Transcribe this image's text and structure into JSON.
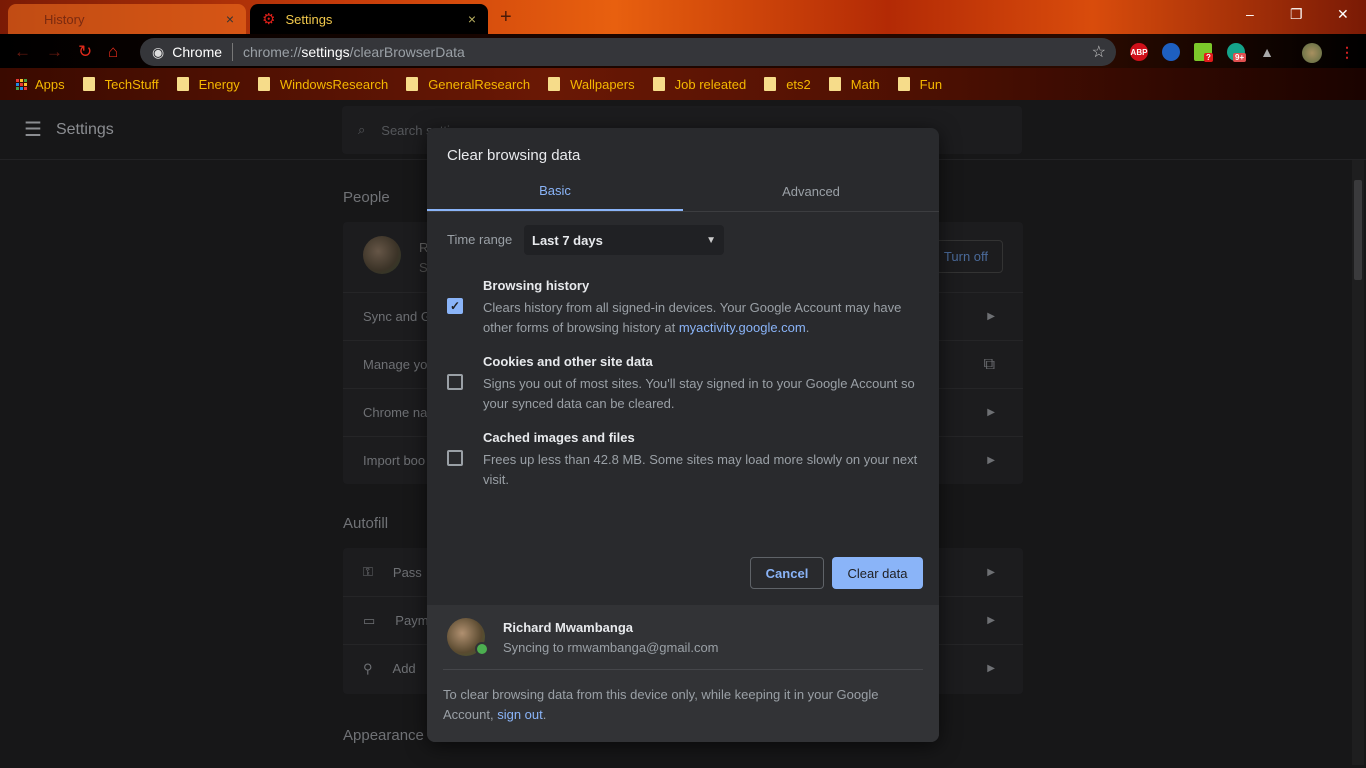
{
  "browser": {
    "tabs": [
      {
        "label": "History",
        "close": "×"
      },
      {
        "label": "Settings",
        "close": "×"
      }
    ],
    "new_tab": "+",
    "window_controls": {
      "minimize": "–",
      "restore": "❐",
      "close": "✕"
    },
    "omnibox": {
      "site": "Chrome",
      "url_prefix": "chrome://",
      "url_bold": "settings",
      "url_suffix": "/clearBrowserData"
    },
    "extensions": [
      {
        "name": "ABP",
        "color": "#d0101a"
      },
      {
        "name": "eagle-icon",
        "color": "#1e5fc0"
      },
      {
        "name": "download-icon",
        "color": "#7cc82a",
        "badge": "?"
      },
      {
        "name": "grammarly-icon",
        "color": "#15a38a",
        "badge": "9+"
      },
      {
        "name": "drive-icon",
        "color": "#9a9a9a"
      }
    ],
    "bookmarks": [
      {
        "label": "Apps"
      },
      {
        "label": "TechStuff"
      },
      {
        "label": "Energy"
      },
      {
        "label": "WindowsResearch"
      },
      {
        "label": "GeneralResearch"
      },
      {
        "label": "Wallpapers"
      },
      {
        "label": "Job releated"
      },
      {
        "label": "ets2"
      },
      {
        "label": "Math"
      },
      {
        "label": "Fun"
      }
    ]
  },
  "settings": {
    "title": "Settings",
    "search_placeholder": "Search settings",
    "people": {
      "title": "People",
      "name_initial": "R",
      "status_initial": "S",
      "turn_off": "Turn off",
      "rows": [
        {
          "label": "Sync and G"
        },
        {
          "label": "Manage yo"
        },
        {
          "label": "Chrome na"
        },
        {
          "label": "Import boo"
        }
      ]
    },
    "autofill": {
      "title": "Autofill",
      "rows": [
        {
          "label": "Pass"
        },
        {
          "label": "Paym"
        },
        {
          "label": "Add"
        }
      ]
    },
    "appearance": {
      "title": "Appearance"
    }
  },
  "dialog": {
    "title": "Clear browsing data",
    "tabs": [
      {
        "label": "Basic",
        "selected": true
      },
      {
        "label": "Advanced",
        "selected": false
      }
    ],
    "time_range_label": "Time range",
    "time_range_value": "Last 7 days",
    "options": [
      {
        "title": "Browsing history",
        "desc": "Clears history from all signed-in devices. Your Google Account may have other forms of browsing history at ",
        "link": "myactivity.google.com",
        "after": ".",
        "checked": true
      },
      {
        "title": "Cookies and other site data",
        "desc": "Signs you out of most sites. You'll stay signed in to your Google Account so your synced data can be cleared.",
        "checked": false
      },
      {
        "title": "Cached images and files",
        "desc": "Frees up less than 42.8 MB. Some sites may load more slowly on your next visit.",
        "checked": false
      }
    ],
    "cancel": "Cancel",
    "clear": "Clear data",
    "account": {
      "name": "Richard Mwambanga",
      "status": "Syncing to rmwambanga@gmail.com"
    },
    "note": "To clear browsing data from this device only, while keeping it in your Google Account, ",
    "note_link": "sign out",
    "note_end": ".",
    "accent": "#8ab4f8"
  }
}
